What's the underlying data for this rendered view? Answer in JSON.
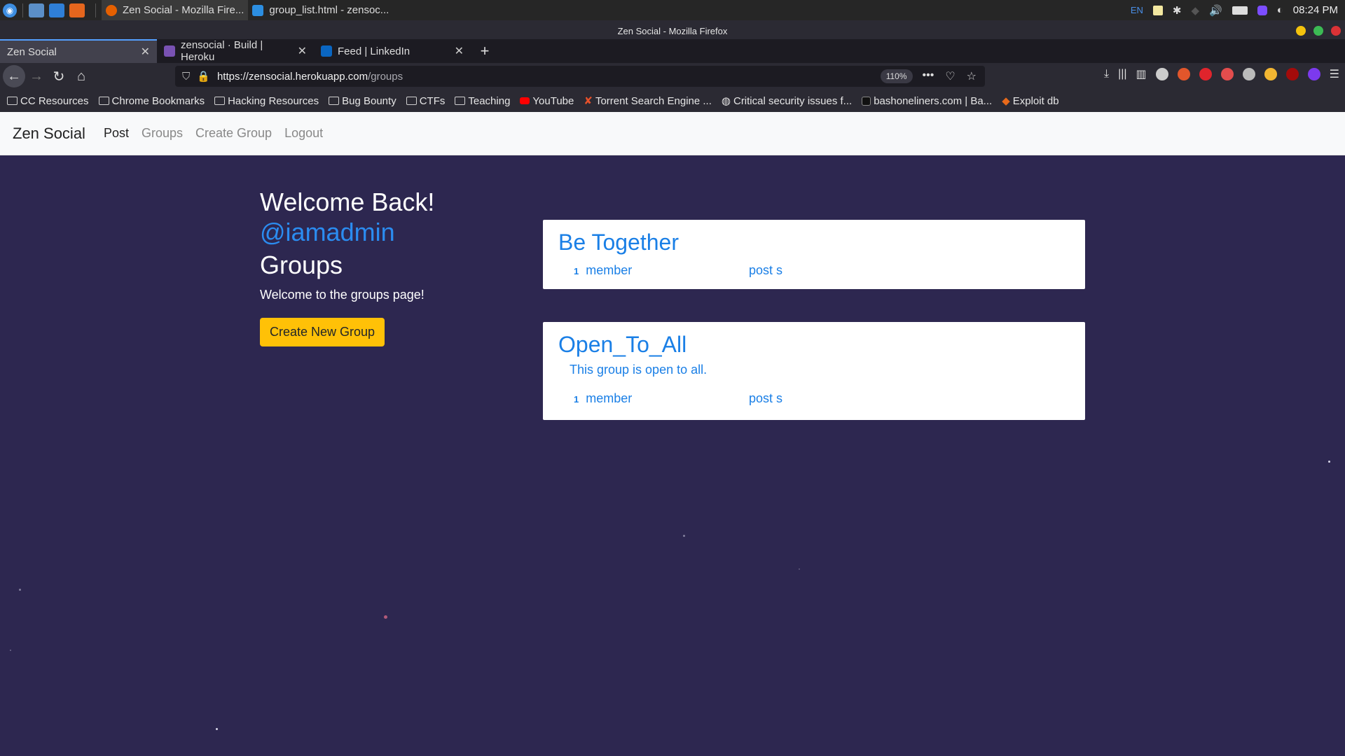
{
  "taskbar": {
    "tasks": [
      {
        "label": "Zen Social - Mozilla Fire..."
      },
      {
        "label": "group_list.html - zensoc..."
      }
    ],
    "lang": "EN",
    "clock": "08:24 PM"
  },
  "window": {
    "title": "Zen Social - Mozilla Firefox"
  },
  "tabs": [
    {
      "label": "Zen Social",
      "favicon_color": "#8a8a8a"
    },
    {
      "label": "zensocial · Build | Heroku",
      "favicon_color": "#7952b3"
    },
    {
      "label": "Feed | LinkedIn",
      "favicon_color": "#0a66c2"
    }
  ],
  "urlbar": {
    "host": "https://zensocial.herokuapp.com",
    "path": "/groups",
    "zoom": "110%"
  },
  "bookmarks": [
    {
      "label": "CC Resources",
      "icon": "folder-icon"
    },
    {
      "label": "Chrome Bookmarks",
      "icon": "folder-icon"
    },
    {
      "label": "Hacking Resources",
      "icon": "folder-icon"
    },
    {
      "label": "Bug Bounty",
      "icon": "folder-icon"
    },
    {
      "label": "CTFs",
      "icon": "folder-icon"
    },
    {
      "label": "Teaching",
      "icon": "folder-icon"
    },
    {
      "label": "YouTube",
      "icon": "youtube-icon"
    },
    {
      "label": "Torrent Search Engine ...",
      "icon": "torrent-icon"
    },
    {
      "label": "Critical security issues f...",
      "icon": "globe-icon"
    },
    {
      "label": "bashoneliners.com | Ba...",
      "icon": "terminal-icon"
    },
    {
      "label": "Exploit  db",
      "icon": "exploit-icon"
    }
  ],
  "site": {
    "brand": "Zen Social",
    "nav": {
      "post": "Post",
      "groups": "Groups",
      "create_group": "Create Group",
      "logout": "Logout"
    }
  },
  "page": {
    "welcome": "Welcome Back!",
    "username": "@iamadmin",
    "heading": "Groups",
    "lead": "Welcome to the groups page!",
    "create_button": "Create New Group"
  },
  "groups": [
    {
      "name": "Be Together",
      "description": "",
      "member_count": "1",
      "member_label": "member",
      "post_label": "post s"
    },
    {
      "name": "Open_To_All",
      "description": "This group is open to all.",
      "member_count": "1",
      "member_label": "member",
      "post_label": "post s"
    }
  ],
  "colors": {
    "background": "#2d2750",
    "accent": "#1a7fe6",
    "button": "#ffc107"
  }
}
